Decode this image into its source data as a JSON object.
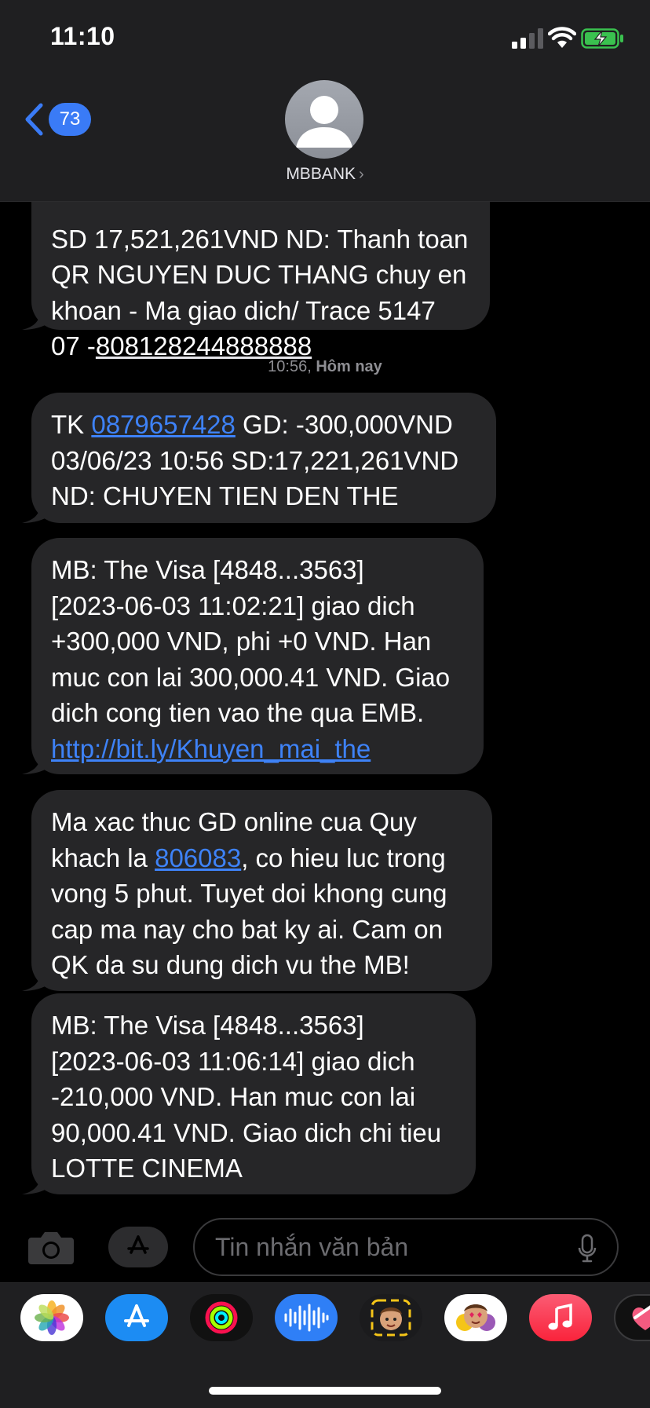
{
  "status_bar": {
    "time": "11:10"
  },
  "header": {
    "back_count": "73",
    "contact_name": "MBBANK",
    "chevron": "›"
  },
  "messages": {
    "m0": {
      "line1": "SD 17,521,261VND ND: Thanh toan",
      "line2": "QR NGUYEN DUC THANG chuy en",
      "line3": "khoan - Ma giao dich/ Trace 5147",
      "line4_prefix": "07 -",
      "line4_underlined": "808128244888888"
    },
    "timestamp": {
      "time": "10:56,",
      "label": "Hôm nay"
    },
    "m1": {
      "prefix": "TK ",
      "account_link": "0879657428",
      "rest": " GD: -300,000VND\n03/06/23 10:56 SD:17,221,261VND\nND: CHUYEN TIEN DEN THE"
    },
    "m2": {
      "text": "MB: The Visa [4848...3563]\n[2023-06-03 11:02:21] giao dich\n+300,000 VND, phi +0 VND. Han\nmuc con lai 300,000.41 VND. Giao\ndich cong tien vao the qua EMB.\n",
      "link": "http://bit.ly/Khuyen_mai_the"
    },
    "m3": {
      "prefix": "Ma xac thuc GD online cua Quy\nkhach la ",
      "otp_link": "806083",
      "rest": ", co hieu luc trong\nvong 5 phut. Tuyet doi khong cung\ncap ma nay cho bat ky ai. Cam on\nQK da su dung dich vu the MB!"
    },
    "m4": {
      "text": "MB: The Visa [4848...3563]\n[2023-06-03 11:06:14] giao dich\n-210,000 VND. Han muc con lai\n90,000.41 VND. Giao dich chi tieu\nLOTTE CINEMA"
    }
  },
  "composer": {
    "placeholder": "Tin nhắn văn bản"
  },
  "tray": {
    "apps": [
      "photos-icon",
      "app-store-icon",
      "activity-icon",
      "audio-messages-icon",
      "memoji-icon",
      "animoji-icon",
      "music-icon",
      "digital-touch-icon"
    ]
  },
  "colors": {
    "bubble": "#262628",
    "link": "#3e82f7",
    "accent": "#3a7bf6",
    "header": "#1f1f21"
  }
}
